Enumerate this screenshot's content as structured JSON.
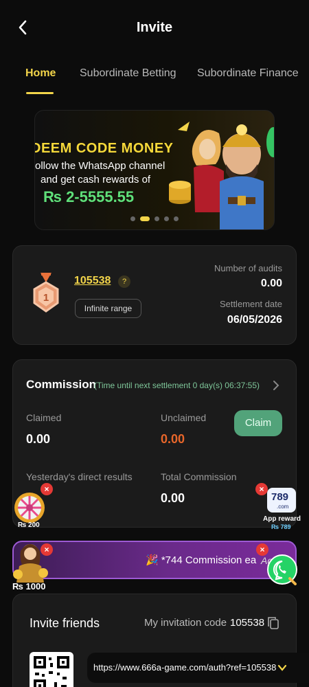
{
  "header": {
    "title": "Invite"
  },
  "tabs": [
    {
      "label": "Home",
      "active": true
    },
    {
      "label": "Subordinate Betting",
      "active": false
    },
    {
      "label": "Subordinate Finance",
      "active": false
    }
  ],
  "banner": {
    "line1": "DEEM CODE MONEY",
    "line2": "ollow the  WhatsApp channel",
    "line3": "and get cash rewards of",
    "line4": "₨ 2-5555.55",
    "slide_index": 2,
    "slide_count": 5
  },
  "profile_card": {
    "user_id": "105538",
    "help_glyph": "?",
    "rank_number": "1",
    "range_label": "Infinite range",
    "audits_label": "Number of audits",
    "audits_value": "0.00",
    "settlement_label": "Settlement date",
    "settlement_value": "06/05/2026"
  },
  "commission": {
    "title": "Commission",
    "timer_text": "(Time until next settlement 0 day(s) 06:37:55)",
    "claimed_label": "Claimed",
    "claimed_value": "0.00",
    "unclaimed_label": "Unclaimed",
    "unclaimed_value": "0.00",
    "claim_button": "Claim",
    "yesterday_label": "Yesterday's direct results",
    "total_label": "Total Commission",
    "total_value": "0.00"
  },
  "floating": {
    "wheel_label": "₨ 200",
    "app_reward_label": "App reward",
    "app_reward_sub": "₨ 789",
    "app_logo": "789",
    "app_logo_sub": ".com",
    "girl_label": "₨ 1000",
    "close_glyph": "×"
  },
  "marquee": {
    "text": "🎉 *744 Commission ea",
    "tail_text": "Ag"
  },
  "invite": {
    "title": "Invite friends",
    "code_label": "My invitation code",
    "code_value": "105538",
    "url": "https://www.666a-game.com/auth?ref=105538"
  },
  "colors": {
    "accent": "#f3d54a",
    "claim_green": "#52a37a",
    "unclaimed_orange": "#e8662a",
    "timer_green": "#7fc79a",
    "banner_amount_green": "#5fe07a",
    "close_red": "#e53935",
    "marquee_purple": "#6a2a8a",
    "whatsapp_green": "#25d366"
  },
  "icons": [
    "back-arrow-icon",
    "question-icon",
    "medal-icon",
    "chevron-right-icon",
    "close-icon",
    "whatsapp-icon",
    "copy-icon",
    "chevron-down-icon",
    "qr-code-icon",
    "wheel-icon"
  ]
}
